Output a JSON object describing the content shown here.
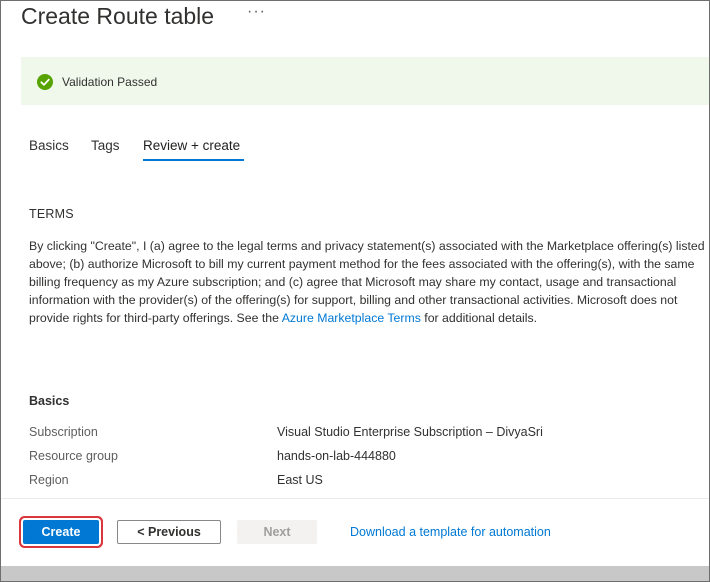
{
  "page": {
    "title": "Create Route table",
    "more_label": "···"
  },
  "banner": {
    "status": "Validation Passed",
    "color": "#f0f8eb",
    "icon": "check-circle-icon"
  },
  "tabs": [
    {
      "label": "Basics",
      "active": false
    },
    {
      "label": "Tags",
      "active": false
    },
    {
      "label": "Review + create",
      "active": true
    }
  ],
  "terms": {
    "heading": "TERMS",
    "body_before_link": "By clicking \"Create\", I (a) agree to the legal terms and privacy statement(s) associated with the Marketplace offering(s) listed above; (b) authorize Microsoft to bill my current payment method for the fees associated with the offering(s), with the same billing frequency as my Azure subscription; and (c) agree that Microsoft may share my contact, usage and transactional information with the provider(s) of the offering(s) for support, billing and other transactional activities. Microsoft does not provide rights for third-party offerings. See the ",
    "link_text": "Azure Marketplace Terms",
    "body_after_link": " for additional details."
  },
  "basics": {
    "heading": "Basics",
    "rows": [
      {
        "key": "Subscription",
        "value": "Visual Studio Enterprise Subscription – DivyaSri"
      },
      {
        "key": "Resource group",
        "value": "hands-on-lab-444880"
      },
      {
        "key": "Region",
        "value": "East US"
      }
    ]
  },
  "footer": {
    "create_label": "Create",
    "previous_label": "< Previous",
    "next_label": "Next",
    "download_label": "Download a template for automation"
  },
  "colors": {
    "accent": "#0078d4",
    "highlight_border": "#d9363e",
    "success": "#57a300"
  }
}
